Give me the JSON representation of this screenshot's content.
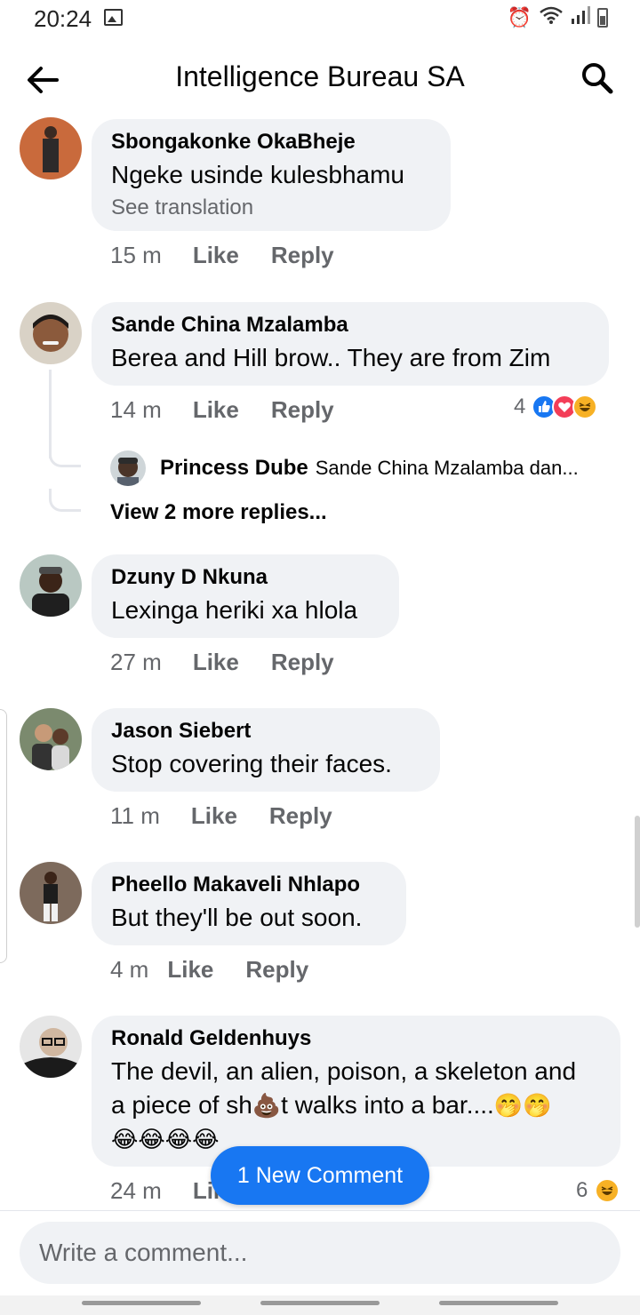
{
  "status_bar": {
    "time": "20:24",
    "icons": [
      "gallery-icon",
      "alarm-icon",
      "wifi-icon",
      "signal-icon",
      "battery-icon"
    ]
  },
  "header": {
    "title": "Intelligence Bureau SA",
    "back_icon": "back-arrow-icon",
    "search_icon": "search-icon"
  },
  "comments": [
    {
      "author": "Sbongakonke OkaBheje",
      "text": "Ngeke usinde kulesbhamu",
      "see_translation": "See translation",
      "time": "15 m",
      "like": "Like",
      "reply": "Reply"
    },
    {
      "author": "Sande China Mzalamba",
      "text": "Berea and Hill brow.. They are from Zim",
      "time": "14 m",
      "like": "Like",
      "reply": "Reply",
      "reaction_count": "4",
      "reactions": [
        "like",
        "love",
        "haha"
      ],
      "reply_preview": {
        "author": "Princess Dube",
        "snippet": "Sande China Mzalamba dan..."
      },
      "view_more": "View 2 more replies..."
    },
    {
      "author": "Dzuny D Nkuna",
      "text": "Lexinga heriki xa hlola",
      "time": "27 m",
      "like": "Like",
      "reply": "Reply"
    },
    {
      "author": "Jason Siebert",
      "text": "Stop covering their faces.",
      "time": "11 m",
      "like": "Like",
      "reply": "Reply"
    },
    {
      "author": "Pheello Makaveli Nhlapo",
      "text": "But they'll be out soon.",
      "time": "4 m",
      "like": "Like",
      "reply": "Reply"
    },
    {
      "author": "Ronald Geldenhuys",
      "text_line1": "The devil, an alien, poison, a skeleton and",
      "text_line2_a": "a piece of sh",
      "text_line2_b": "t walks into a bar....",
      "text_line2_emoji": "🤭🤭",
      "text_line3": "😂😂😂😂",
      "inline_emoji": "💩",
      "time": "24 m",
      "like": "Like",
      "reaction_count": "6",
      "reactions": [
        "haha"
      ]
    }
  ],
  "new_comment_pill": "1 New Comment",
  "composer": {
    "placeholder": "Write a comment..."
  },
  "colors": {
    "accent": "#1877f2",
    "bubble": "#f0f2f5",
    "secondary_text": "#65676b"
  }
}
